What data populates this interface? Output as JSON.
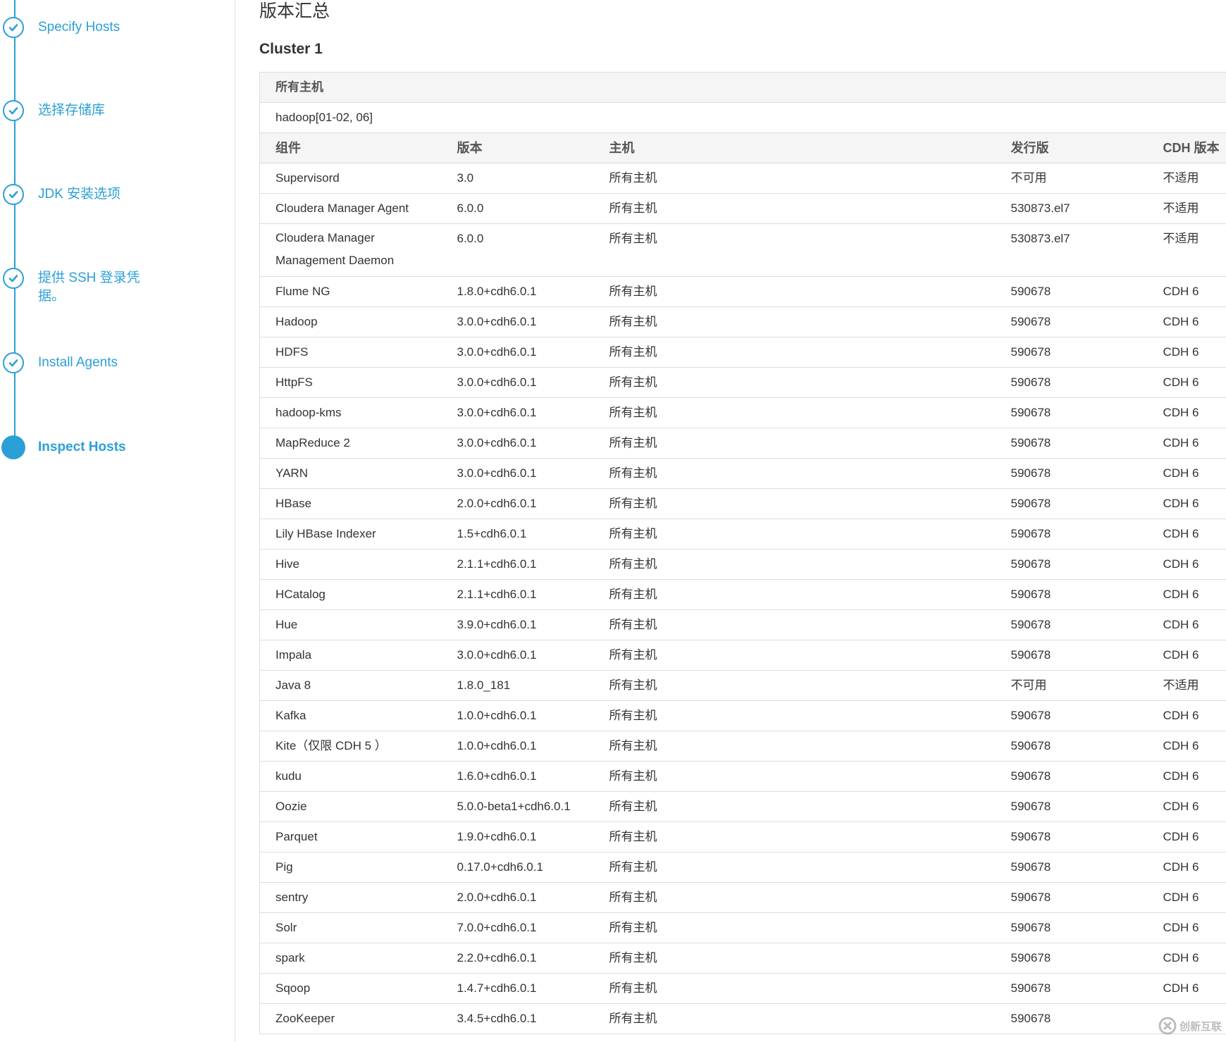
{
  "sidebar": {
    "steps": [
      {
        "label": "Specify Hosts",
        "state": "complete"
      },
      {
        "label": "选择存储库",
        "state": "complete"
      },
      {
        "label": "JDK 安装选项",
        "state": "complete"
      },
      {
        "label": "提供 SSH 登录凭据。",
        "state": "complete"
      },
      {
        "label": "Install Agents",
        "state": "complete"
      },
      {
        "label": "Inspect Hosts",
        "state": "active"
      }
    ],
    "accent_color": "#2ba0d6"
  },
  "main": {
    "title": "版本汇总",
    "cluster_title": "Cluster 1",
    "table": {
      "group_label": "所有主机",
      "host_range": "hadoop[01-02, 06]",
      "columns": [
        "组件",
        "版本",
        "主机",
        "发行版",
        "CDH 版本"
      ],
      "rows": [
        [
          "Supervisord",
          "3.0",
          "所有主机",
          "不可用",
          "不适用"
        ],
        [
          "Cloudera Manager Agent",
          "6.0.0",
          "所有主机",
          "530873.el7",
          "不适用"
        ],
        [
          "Cloudera Manager Management Daemon",
          "6.0.0",
          "所有主机",
          "530873.el7",
          "不适用"
        ],
        [
          "Flume NG",
          "1.8.0+cdh6.0.1",
          "所有主机",
          "590678",
          "CDH 6"
        ],
        [
          "Hadoop",
          "3.0.0+cdh6.0.1",
          "所有主机",
          "590678",
          "CDH 6"
        ],
        [
          "HDFS",
          "3.0.0+cdh6.0.1",
          "所有主机",
          "590678",
          "CDH 6"
        ],
        [
          "HttpFS",
          "3.0.0+cdh6.0.1",
          "所有主机",
          "590678",
          "CDH 6"
        ],
        [
          "hadoop-kms",
          "3.0.0+cdh6.0.1",
          "所有主机",
          "590678",
          "CDH 6"
        ],
        [
          "MapReduce 2",
          "3.0.0+cdh6.0.1",
          "所有主机",
          "590678",
          "CDH 6"
        ],
        [
          "YARN",
          "3.0.0+cdh6.0.1",
          "所有主机",
          "590678",
          "CDH 6"
        ],
        [
          "HBase",
          "2.0.0+cdh6.0.1",
          "所有主机",
          "590678",
          "CDH 6"
        ],
        [
          "Lily HBase Indexer",
          "1.5+cdh6.0.1",
          "所有主机",
          "590678",
          "CDH 6"
        ],
        [
          "Hive",
          "2.1.1+cdh6.0.1",
          "所有主机",
          "590678",
          "CDH 6"
        ],
        [
          "HCatalog",
          "2.1.1+cdh6.0.1",
          "所有主机",
          "590678",
          "CDH 6"
        ],
        [
          "Hue",
          "3.9.0+cdh6.0.1",
          "所有主机",
          "590678",
          "CDH 6"
        ],
        [
          "Impala",
          "3.0.0+cdh6.0.1",
          "所有主机",
          "590678",
          "CDH 6"
        ],
        [
          "Java 8",
          "1.8.0_181",
          "所有主机",
          "不可用",
          "不适用"
        ],
        [
          "Kafka",
          "1.0.0+cdh6.0.1",
          "所有主机",
          "590678",
          "CDH 6"
        ],
        [
          "Kite（仅限 CDH 5 ）",
          "1.0.0+cdh6.0.1",
          "所有主机",
          "590678",
          "CDH 6"
        ],
        [
          "kudu",
          "1.6.0+cdh6.0.1",
          "所有主机",
          "590678",
          "CDH 6"
        ],
        [
          "Oozie",
          "5.0.0-beta1+cdh6.0.1",
          "所有主机",
          "590678",
          "CDH 6"
        ],
        [
          "Parquet",
          "1.9.0+cdh6.0.1",
          "所有主机",
          "590678",
          "CDH 6"
        ],
        [
          "Pig",
          "0.17.0+cdh6.0.1",
          "所有主机",
          "590678",
          "CDH 6"
        ],
        [
          "sentry",
          "2.0.0+cdh6.0.1",
          "所有主机",
          "590678",
          "CDH 6"
        ],
        [
          "Solr",
          "7.0.0+cdh6.0.1",
          "所有主机",
          "590678",
          "CDH 6"
        ],
        [
          "spark",
          "2.2.0+cdh6.0.1",
          "所有主机",
          "590678",
          "CDH 6"
        ],
        [
          "Sqoop",
          "1.4.7+cdh6.0.1",
          "所有主机",
          "590678",
          "CDH 6"
        ],
        [
          "ZooKeeper",
          "3.4.5+cdh6.0.1",
          "所有主机",
          "590678",
          ""
        ]
      ]
    }
  },
  "watermark": {
    "text": "创新互联",
    "icon": "chuangxin-logo-icon"
  }
}
